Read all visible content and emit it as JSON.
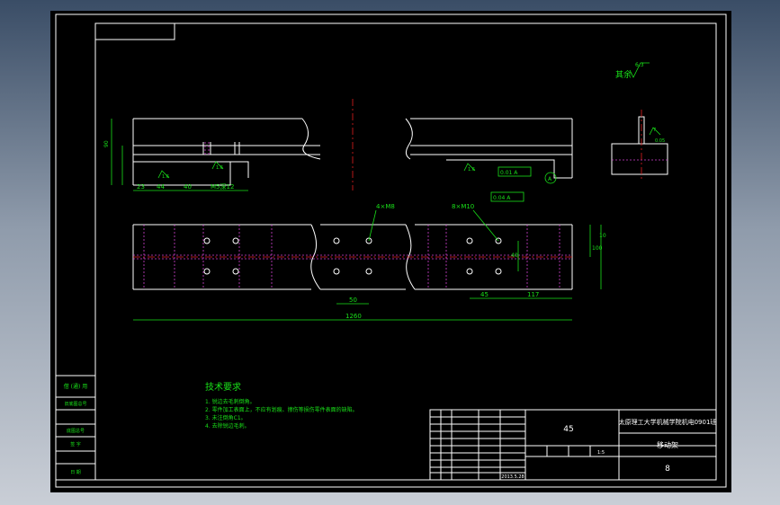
{
  "drawing": {
    "roughness": {
      "label": "其余",
      "value": "6.3"
    },
    "roughness_marks": [
      "1.6",
      "1.6",
      "1.6",
      "0.8"
    ],
    "dims_front": [
      "23",
      "44",
      "40",
      "M5深12"
    ],
    "dims_side": [
      "7",
      "0.05"
    ],
    "gdt": [
      "0.01 A",
      "0.04 A",
      "A"
    ],
    "plan_callouts": [
      "4×M8",
      "8×M10"
    ],
    "plan_dims": [
      "50",
      "45",
      "117",
      "1260",
      "10",
      "100",
      "40"
    ]
  },
  "tech_req": {
    "title": "技术要求",
    "items": [
      "1. 锐边去毛刺倒角。",
      "2. 零件加工表面上，不应有划痕、擦伤等损伤零件表面的缺陷。",
      "3. 未注倒角C1。",
      "4. 去除锐边毛刺。"
    ]
  },
  "title_block": {
    "material": "45",
    "school": "太原理工大学机械学院机电0901班",
    "part_name": "移动架",
    "drawing_no": "8",
    "scale": "1:5",
    "date": "2013.5.28"
  },
  "left_strip": {
    "items": [
      "借 (通) 用",
      "旧底图总号",
      "底图总号",
      "签 字",
      "日 期"
    ]
  },
  "colors": {
    "background": "#000000",
    "line": "#ffffff",
    "dim": "#19e019",
    "centerline": "#e02020",
    "hidden": "#d040d0"
  }
}
